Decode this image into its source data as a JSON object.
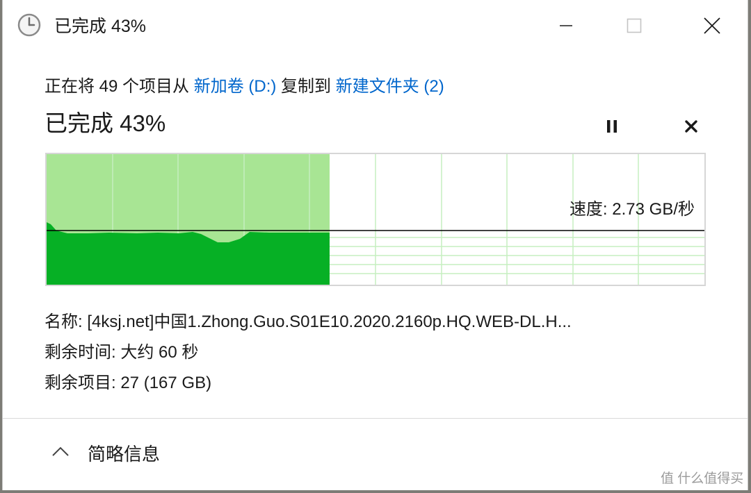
{
  "window": {
    "title": "已完成 43%",
    "controls": {
      "minimize": "minimize-icon",
      "maximize": "maximize-icon",
      "close": "close-icon"
    }
  },
  "description": {
    "prefix": "正在将 49 个项目从 ",
    "source": "新加卷 (D:)",
    "middle": " 复制到 ",
    "destination": "新建文件夹 (2)"
  },
  "progress": {
    "label": "已完成 43%",
    "percent": 43,
    "pause_icon": "pause-icon",
    "cancel_icon": "cancel-icon"
  },
  "graph": {
    "speed_label": "速度: 2.73 GB/秒"
  },
  "details": {
    "name": "名称: [4ksj.net]中国1.Zhong.Guo.S01E10.2020.2160p.HQ.WEB-DL.H...",
    "time_remaining": "剩余时间: 大约 60 秒",
    "items_remaining": "剩余项目: 27 (167 GB)"
  },
  "footer": {
    "toggle_label": "简略信息",
    "toggle_icon": "chevron-up-icon"
  },
  "watermark": "值 什么值得买",
  "colors": {
    "link": "#0066cc",
    "progress_fill": "#a8e594",
    "speed_fill": "#06b025",
    "grid_line": "#c6efc0"
  }
}
